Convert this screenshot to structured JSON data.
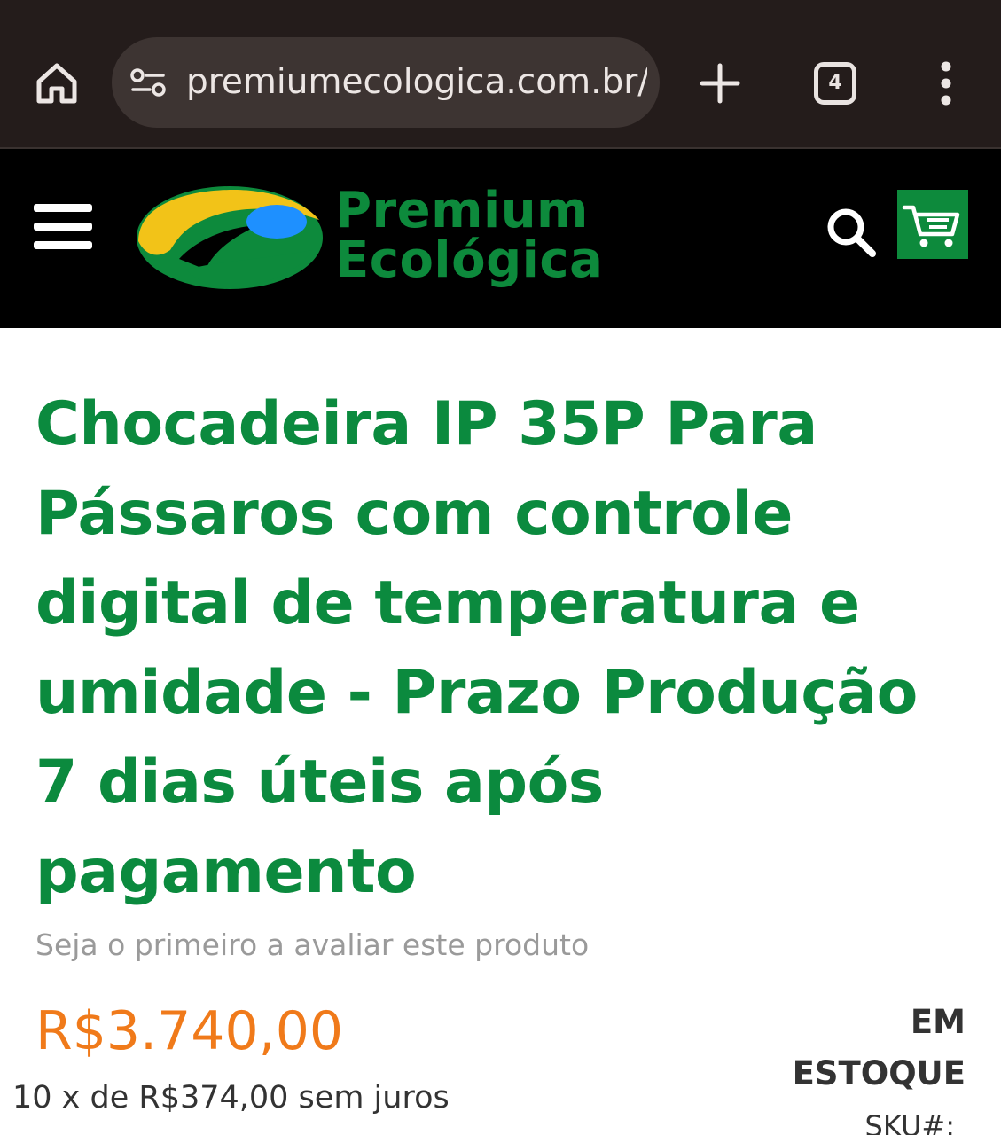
{
  "browser": {
    "url": "premiumecologica.com.br/c",
    "tab_count": "4"
  },
  "site": {
    "brand_line1": "Premium",
    "brand_line2": "Ecológica",
    "colors": {
      "brand_green": "#0d8a3c",
      "price_orange": "#f07a1a",
      "logo_yellow": "#f2c318",
      "logo_blue": "#1e90ff"
    }
  },
  "product": {
    "title": "Chocadeira IP 35P Para Pássaros com controle digital de temperatura e umidade - Prazo Produção 7 dias úteis após pagamento",
    "review_prompt": "Seja o primeiro a avaliar este produto",
    "price": "R$3.740,00",
    "installments": "10 x de R$374,00 sem juros",
    "stock_line1": "EM",
    "stock_line2": "ESTOQUE",
    "sku_label": "SKU#:"
  },
  "icons": {
    "home": "home-icon",
    "site_settings": "tune-icon",
    "new_tab": "plus-icon",
    "tabs": "tab-switcher-icon",
    "menu": "more-vert-icon",
    "nav": "hamburger-icon",
    "search": "search-icon",
    "cart": "cart-icon"
  }
}
